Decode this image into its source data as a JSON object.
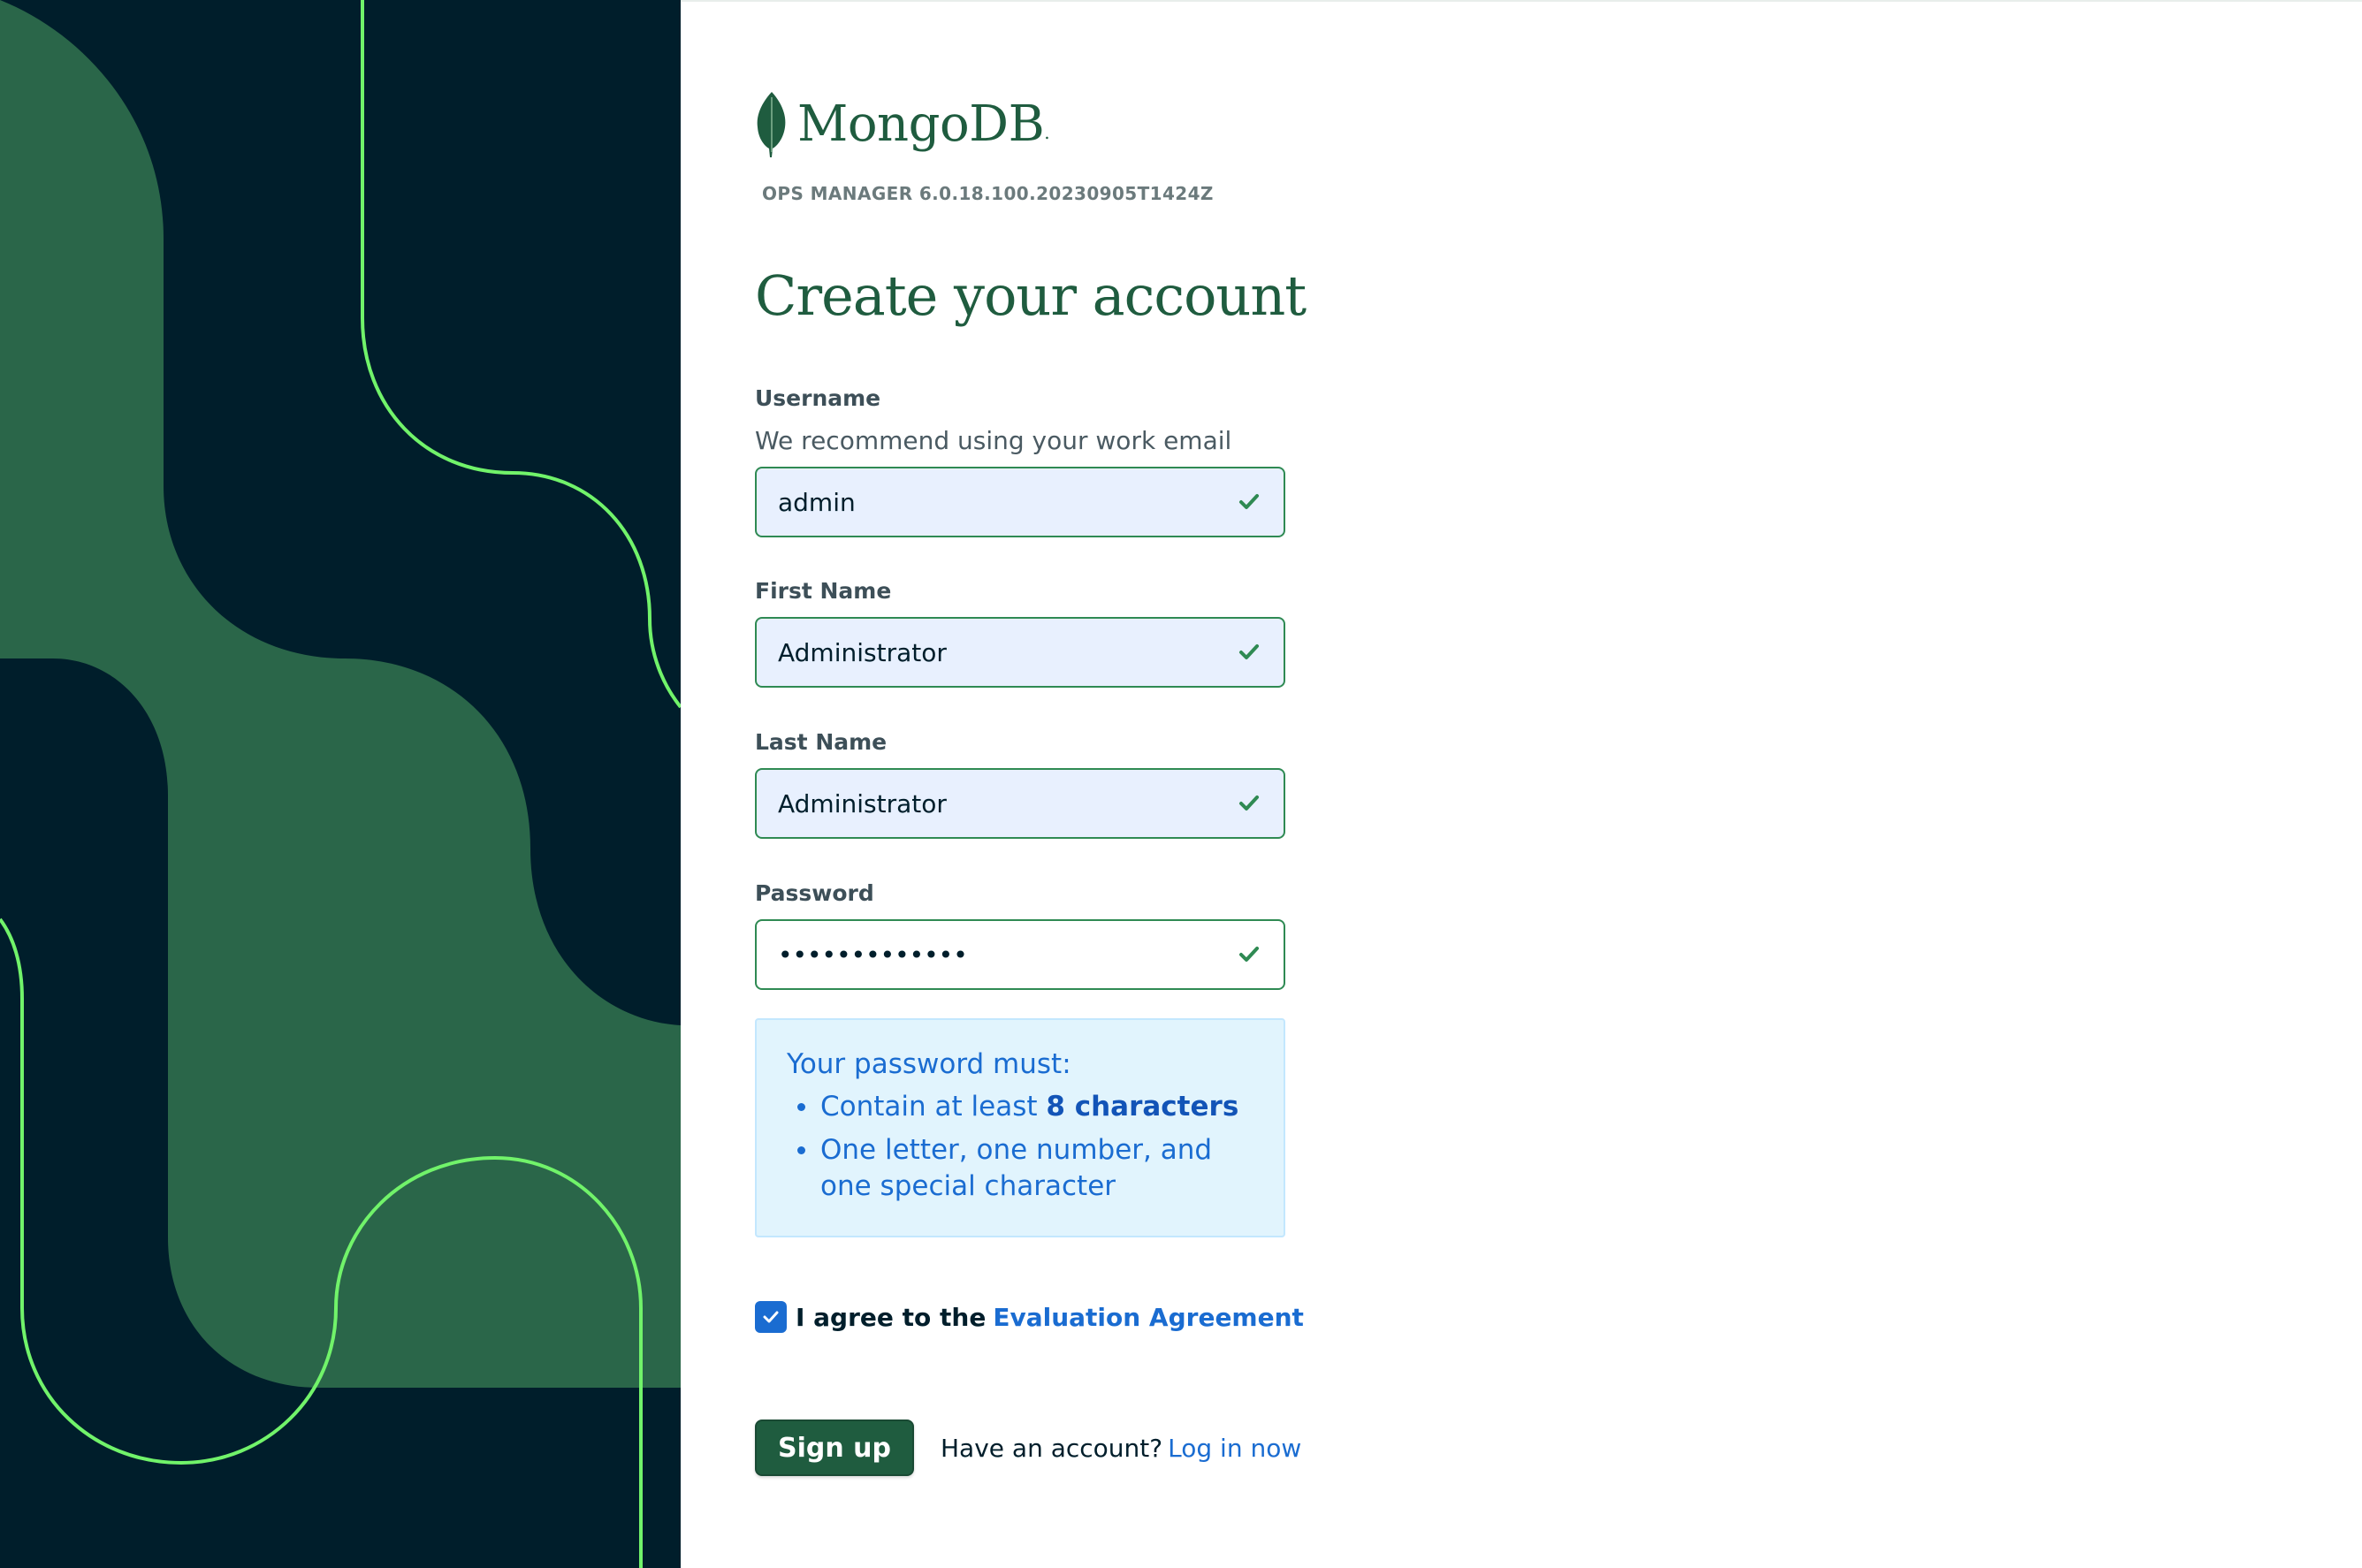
{
  "brand": {
    "name": "MongoDB",
    "trademark": ".",
    "version": "OPS MANAGER 6.0.18.100.20230905T1424Z"
  },
  "form": {
    "title": "Create your account",
    "username": {
      "label": "Username",
      "hint": "We recommend using your work email",
      "value": "admin"
    },
    "first_name": {
      "label": "First Name",
      "value": "Administrator"
    },
    "last_name": {
      "label": "Last Name",
      "value": "Administrator"
    },
    "password": {
      "label": "Password",
      "value": "•••••••••••••"
    },
    "password_rules": {
      "heading": "Your password must:",
      "rule1_prefix": "Contain at least ",
      "rule1_bold": "8 characters",
      "rule2": "One letter, one number, and one special character"
    },
    "agreement": {
      "checked": true,
      "text": "I agree to the",
      "link": "Evaluation Agreement"
    },
    "submit_label": "Sign up",
    "have_account": "Have an account?",
    "login_link": "Log in now"
  },
  "colors": {
    "brand_green": "#1f5c3f",
    "art_dark": "#001e2b",
    "art_green": "#2a6649",
    "accent_line": "#71f36a",
    "link_blue": "#1a6cd1",
    "valid_green": "#2f8a53",
    "info_bg": "#e1f4fd"
  },
  "icons": {
    "logo": "mongodb-leaf-icon",
    "valid": "checkmark-icon",
    "checkbox": "checkbox-checked-icon"
  }
}
